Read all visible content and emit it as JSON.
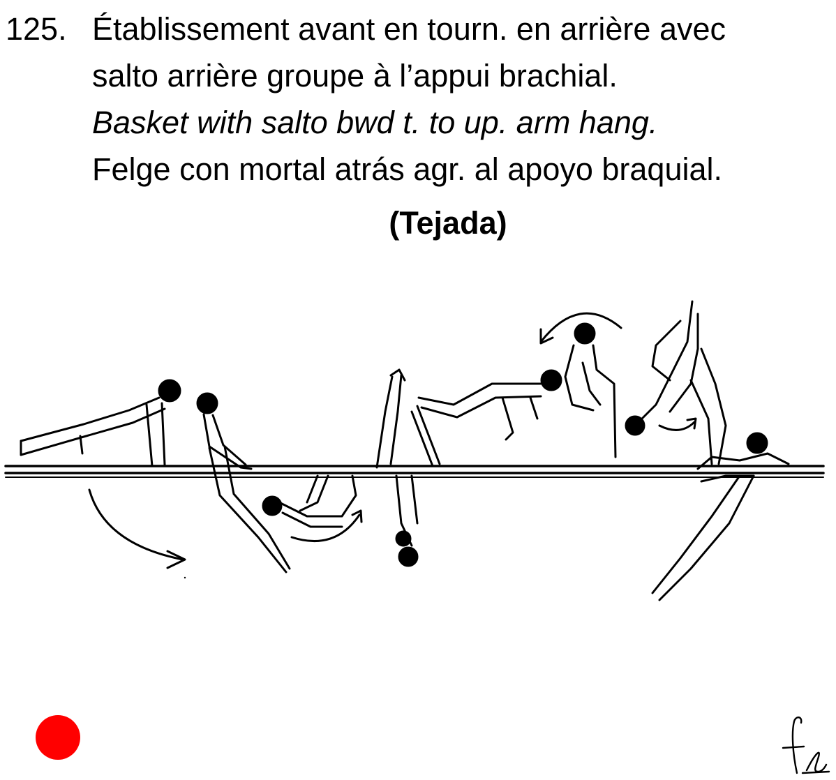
{
  "element": {
    "number": "125.",
    "lines": [
      "Établissement avant en tourn. en arrière avec",
      "salto arrière groupe à l’appui brachial.",
      "Basket with salto bwd t. to up. arm hang.",
      "Felge con mortal atrás agr. al apoyo braquial."
    ],
    "name": "(Tejada)"
  },
  "colors": {
    "value_dot": "#ff0000",
    "ink": "#000000"
  },
  "icons": {
    "value_marker": "red-circle",
    "signature": "handwritten-signature"
  },
  "signature_text": "fe"
}
